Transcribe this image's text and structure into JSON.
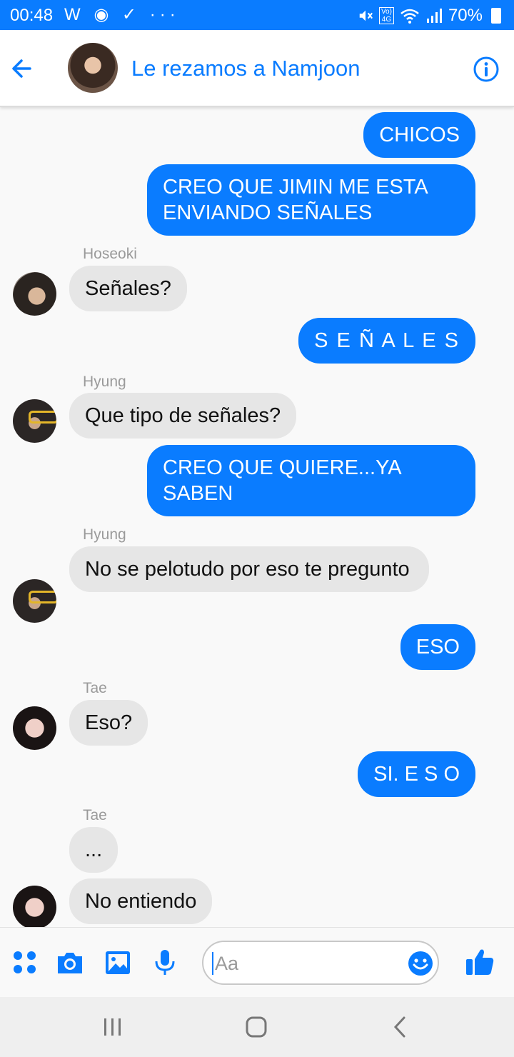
{
  "status_bar": {
    "time": "00:48",
    "left_icons": "W ◉ ✓ ···",
    "volte": "Vo)\n4G",
    "battery": "70%"
  },
  "header": {
    "title": "Le rezamos a Namjoon"
  },
  "messages": [
    {
      "text": "CHICOS"
    },
    {
      "text": "CREO QUE JIMIN ME ESTA ENVIANDO SEÑALES"
    },
    {
      "sender": "Hoseoki",
      "text": "Señales?"
    },
    {
      "text": "S E Ñ A L E S"
    },
    {
      "sender": "Hyung",
      "text": "Que tipo de señales?"
    },
    {
      "text": "CREO QUE QUIERE...YA SABEN"
    },
    {
      "sender": "Hyung",
      "text": "No se pelotudo por eso te pregunto"
    },
    {
      "text": "ESO"
    },
    {
      "sender": "Tae",
      "text": "Eso?"
    },
    {
      "text": "SI. E S O"
    },
    {
      "sender": "Tae",
      "text": "..."
    },
    {
      "text": "No entiendo"
    }
  ],
  "composer": {
    "placeholder": "Aa"
  },
  "colors": {
    "accent": "#0a7cff",
    "incoming_bubble": "#e6e6e6"
  }
}
